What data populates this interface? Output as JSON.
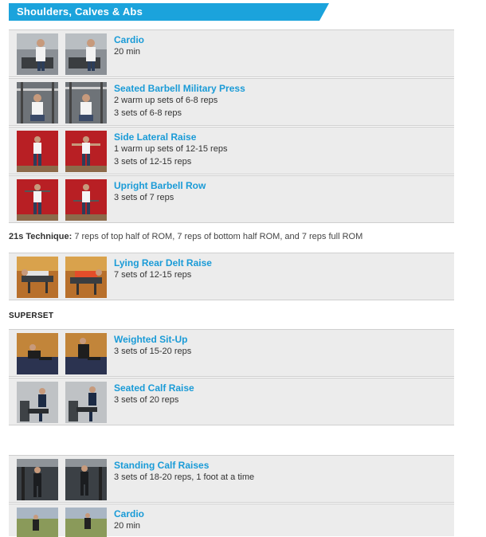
{
  "header": {
    "title": "Shoulders, Calves & Abs",
    "color": "#1ba3dc"
  },
  "accent_color": "#1a9bd7",
  "exercises": [
    {
      "name": "Cardio",
      "lines": [
        "20 min"
      ],
      "thumbs": [
        "treadmill-photo",
        "treadmill-photo"
      ]
    },
    {
      "name": "Seated Barbell Military Press",
      "lines": [
        "2 warm up sets of 6-8 reps",
        "3 sets of 6-8 reps"
      ],
      "thumbs": [
        "gym-press-photo",
        "gym-press-photo"
      ]
    },
    {
      "name": "Side Lateral Raise",
      "lines": [
        "1 warm up sets of 12-15 reps",
        "3 sets of 12-15 reps"
      ],
      "thumbs": [
        "red-backdrop-photo",
        "red-backdrop-photo"
      ]
    },
    {
      "name": "Upright Barbell Row",
      "lines": [
        "3 sets of 7 reps"
      ],
      "thumbs": [
        "red-backdrop-photo",
        "red-backdrop-photo"
      ]
    },
    {
      "name": "Lying Rear Delt Raise",
      "lines": [
        "7 sets of 12-15 reps"
      ],
      "thumbs": [
        "bench-photo",
        "bench-photo"
      ]
    },
    {
      "name": "Weighted Sit-Up",
      "lines": [
        "3 sets of 15-20 reps"
      ],
      "thumbs": [
        "floor-photo",
        "floor-photo"
      ]
    },
    {
      "name": "Seated Calf Raise",
      "lines": [
        "3 sets of 20 reps"
      ],
      "thumbs": [
        "machine-photo",
        "machine-photo"
      ]
    },
    {
      "name": "Standing Calf Raises",
      "lines": [
        "3 sets of 18-20 reps, 1 foot at a time"
      ],
      "thumbs": [
        "gym-dark-photo",
        "gym-dark-photo"
      ]
    },
    {
      "name": "Cardio",
      "lines": [
        "20 min"
      ],
      "thumbs": [
        "outdoor-photo",
        "outdoor-photo"
      ]
    }
  ],
  "technique_note": {
    "label": "21s Technique:",
    "text": " 7 reps of top half of ROM, 7 reps of bottom half ROM, and 7 reps full ROM"
  },
  "superset_label": "SUPERSET"
}
